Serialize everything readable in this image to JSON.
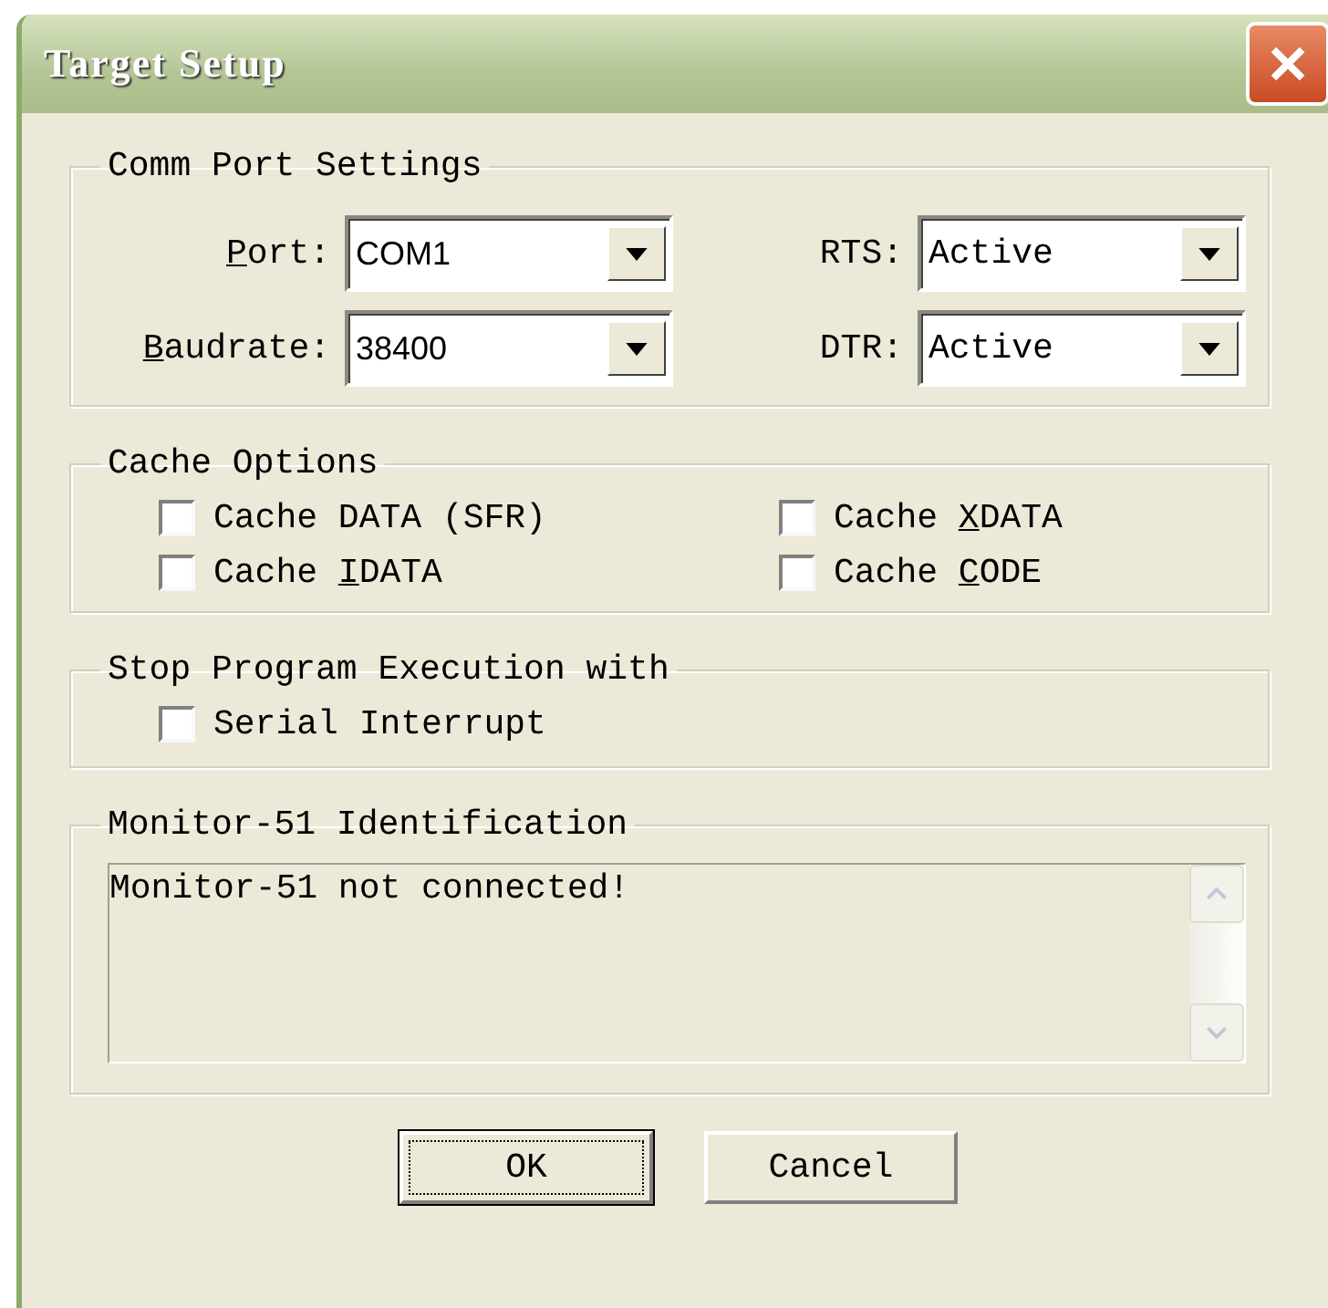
{
  "window": {
    "title": "Target Setup"
  },
  "comm_port_settings": {
    "title": "Comm Port Settings",
    "fields": [
      {
        "label": {
          "key": "P",
          "after": "ort:"
        },
        "value": "COM1"
      },
      {
        "label": {
          "before": "RTS:"
        },
        "value": "Active"
      },
      {
        "label": {
          "key": "B",
          "after": "audrate:"
        },
        "value": "38400"
      },
      {
        "label": {
          "before": "DTR:"
        },
        "value": "Active"
      }
    ]
  },
  "cache_options": {
    "title": "Cache Options",
    "options": [
      {
        "label": {
          "before": "Cache DATA (SFR)"
        },
        "checked": false
      },
      {
        "label": {
          "before": "Cache ",
          "key": "X",
          "after": "DATA"
        },
        "checked": false
      },
      {
        "label": {
          "before": "Cache ",
          "key": "I",
          "after": "DATA"
        },
        "checked": false
      },
      {
        "label": {
          "before": "Cache ",
          "key": "C",
          "after": "ODE"
        },
        "checked": false
      }
    ]
  },
  "stop_program_execution": {
    "title": "Stop Program Execution with",
    "options": [
      {
        "label": {
          "before": "Serial Interrupt"
        },
        "checked": false
      }
    ]
  },
  "identification": {
    "title": "Monitor-51 Identification",
    "text": "Monitor-51 not connected!"
  },
  "buttons": [
    {
      "label": "OK",
      "selected": true
    },
    {
      "label": "Cancel",
      "selected": false
    }
  ]
}
